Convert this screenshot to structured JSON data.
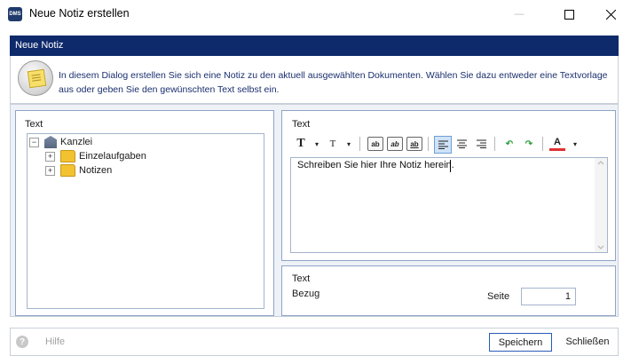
{
  "window": {
    "app_icon_text": "DMS",
    "title": "Neue Notiz erstellen",
    "controls": {
      "help": "—",
      "maximize": "☐",
      "close": "✕"
    }
  },
  "banner": {
    "title": "Neue Notiz"
  },
  "info": {
    "text": "In diesem Dialog erstellen Sie sich eine Notiz zu den aktuell ausgewählten Dokumenten. Wählen Sie dazu entweder eine Textvorlage aus oder geben Sie den gewünschten Text selbst ein."
  },
  "left_panel": {
    "title": "Text",
    "tree": [
      {
        "label": "Kanzlei",
        "expander": "−",
        "icon": "building-icon"
      },
      {
        "label": "Einzelaufgaben",
        "expander": "+",
        "icon": "folder-icon"
      },
      {
        "label": "Notizen",
        "expander": "+",
        "icon": "folder-icon"
      }
    ]
  },
  "editor_panel": {
    "title": "Text",
    "toolbar": {
      "font": "T",
      "size": "T",
      "bold": "ab",
      "italic": "ab",
      "underline": "ab",
      "undo": "↶",
      "redo": "↷",
      "color": "A",
      "dropdown": "▾"
    },
    "content": "Schreiben Sie hier Ihre Notiz herein."
  },
  "details_panel": {
    "title": "Text",
    "bezug_label": "Bezug",
    "seite_label": "Seite",
    "seite_value": "1"
  },
  "footer": {
    "help_icon": "?",
    "help_label": "Hilfe",
    "save_label": "Speichern",
    "close_label": "Schließen"
  }
}
